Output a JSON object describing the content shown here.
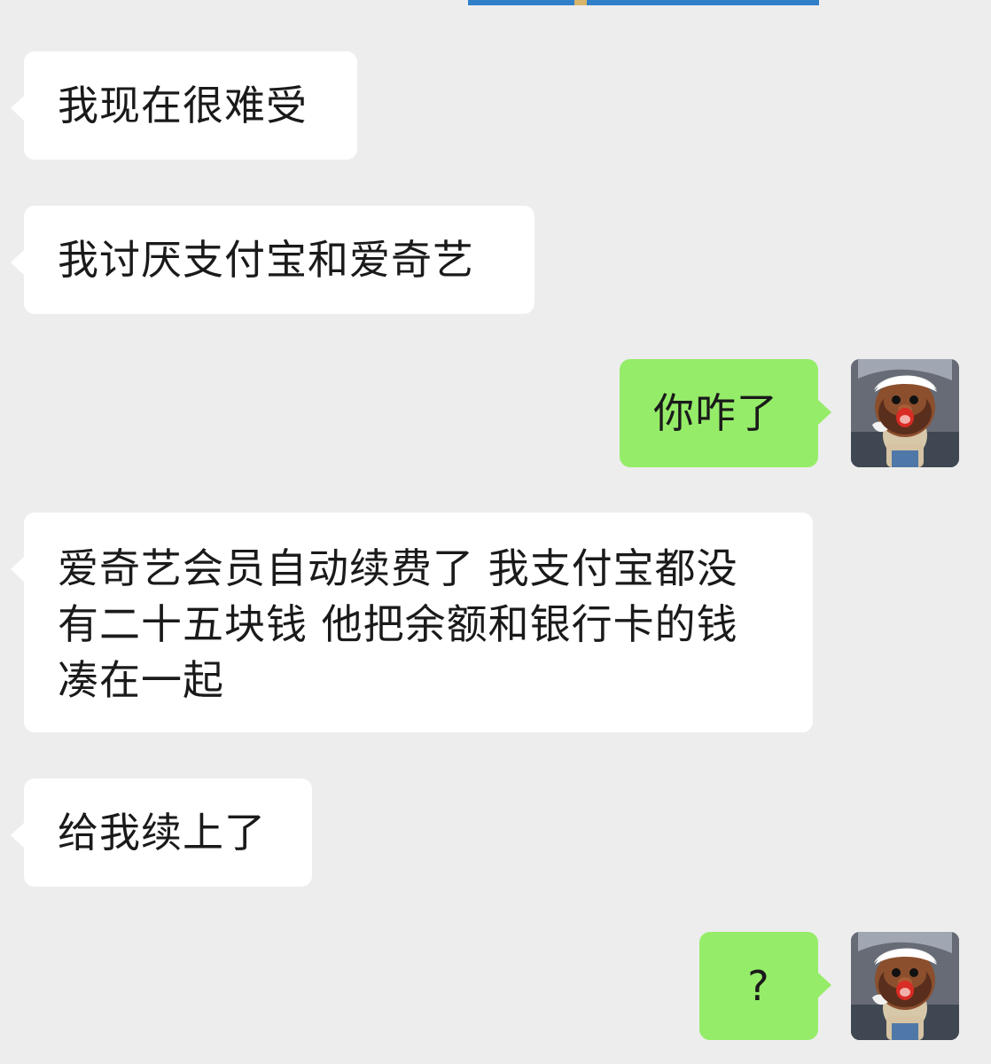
{
  "messages": [
    {
      "side": "incoming",
      "text": "我现在很难受"
    },
    {
      "side": "incoming",
      "text": "我讨厌支付宝和爱奇艺"
    },
    {
      "side": "outgoing",
      "text": "你咋了"
    },
    {
      "side": "incoming",
      "lines": [
        "爱奇艺会员自动续费了 我支付宝都没",
        "有二十五块钱 他把余额和银行卡的钱",
        "凑在一起"
      ]
    },
    {
      "side": "incoming",
      "text": "给我续上了"
    },
    {
      "side": "outgoing",
      "text": "?"
    }
  ],
  "avatar": {
    "icon": "cartoon-bearded-man-avatar-icon"
  },
  "colors": {
    "background": "#ededed",
    "incoming_bubble": "#ffffff",
    "outgoing_bubble": "#95ec69",
    "text": "#1a1a1a"
  }
}
